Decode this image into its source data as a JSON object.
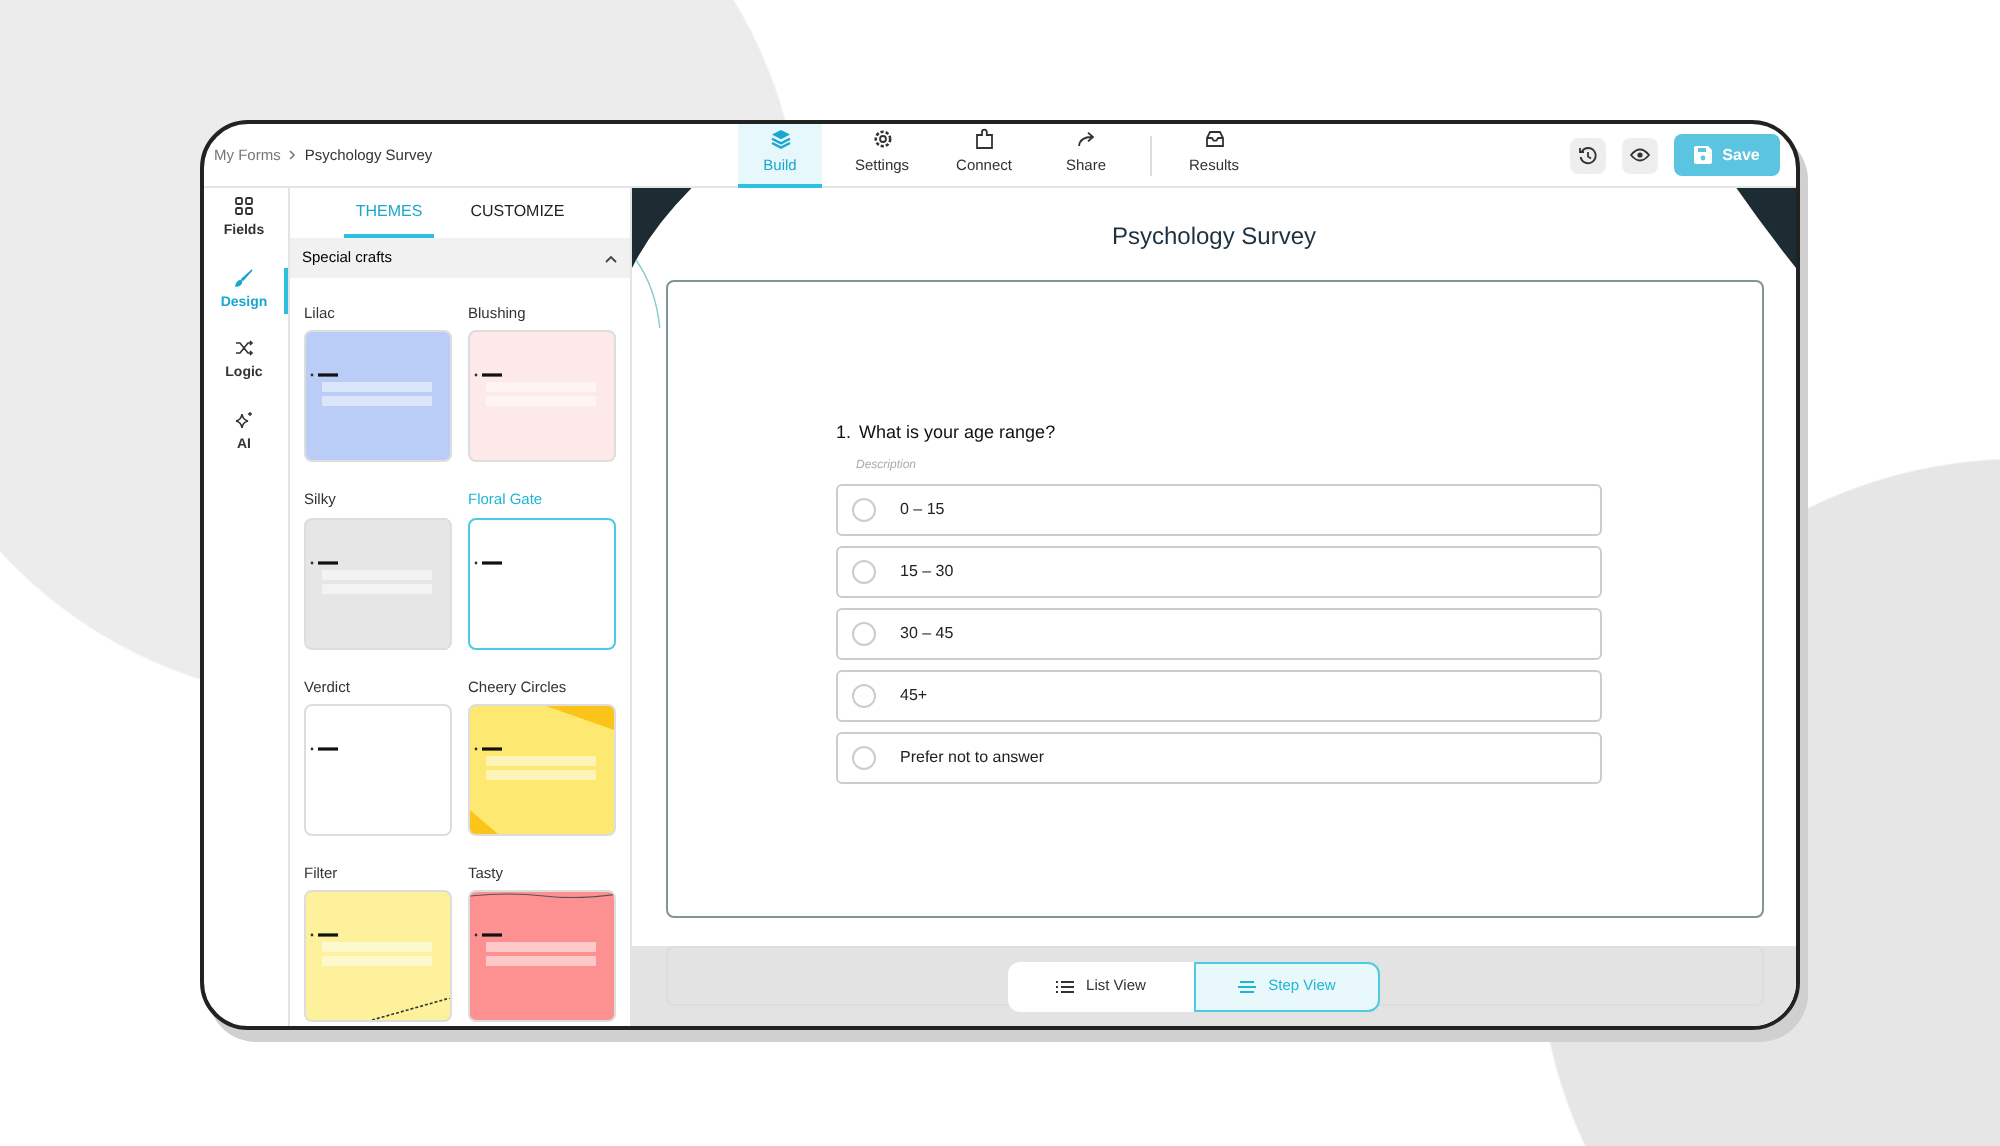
{
  "breadcrumb": [
    "My Forms",
    "Psychology Survey"
  ],
  "nav": [
    {
      "label": "Build",
      "kind": "build",
      "selected": true
    },
    {
      "label": "Settings",
      "kind": "settings",
      "selected": false
    },
    {
      "label": "Connect",
      "kind": "connect",
      "selected": false
    },
    {
      "label": "Share",
      "kind": "share",
      "selected": false
    },
    {
      "label": "Results",
      "kind": "results",
      "selected": false
    }
  ],
  "save_button": "Save",
  "rail": [
    {
      "label": "Fields",
      "kind": "fields",
      "selected": false
    },
    {
      "label": "Design",
      "kind": "design",
      "selected": true
    },
    {
      "label": "Logic",
      "kind": "logic",
      "selected": false
    },
    {
      "label": "AI",
      "kind": "ai",
      "selected": false
    }
  ],
  "panel_tabs": [
    {
      "label": "THEMES",
      "selected": true
    },
    {
      "label": "CUSTOMIZE",
      "selected": false
    }
  ],
  "section": {
    "title": "Special crafts",
    "expanded": true
  },
  "themes": [
    {
      "name": "Lilac",
      "color": "#b9cdf7",
      "kind": "plain",
      "selected": false
    },
    {
      "name": "Blushing",
      "color": "#fde9e9",
      "kind": "plain",
      "selected": false
    },
    {
      "name": "Silky",
      "color": "#e6e6e6",
      "kind": "plain",
      "selected": false
    },
    {
      "name": "Floral Gate",
      "color": "#ffffff",
      "kind": "plain",
      "selected": true
    },
    {
      "name": "Verdict",
      "color": "#ffffff",
      "kind": "plain",
      "selected": false
    },
    {
      "name": "Cheery Circles",
      "color": "#fde971",
      "kind": "corners",
      "selected": false
    },
    {
      "name": "Filter",
      "color": "#fdf29b",
      "kind": "dashed",
      "selected": false
    },
    {
      "name": "Tasty",
      "color": "#fd9191",
      "kind": "wavy",
      "selected": false
    }
  ],
  "form": {
    "title": "Psychology Survey",
    "number": "1.",
    "question": "What is your age range?",
    "description": "Description",
    "options": [
      {
        "label": "0 – 15",
        "selected": false
      },
      {
        "label": "15 – 30",
        "selected": false
      },
      {
        "label": "30 – 45",
        "selected": false
      },
      {
        "label": "45+",
        "selected": false
      },
      {
        "label": "Prefer not to answer",
        "selected": false
      }
    ]
  },
  "views": [
    {
      "label": "List View",
      "kind": "list",
      "selected": false
    },
    {
      "label": "Step View",
      "kind": "step",
      "selected": true
    }
  ]
}
